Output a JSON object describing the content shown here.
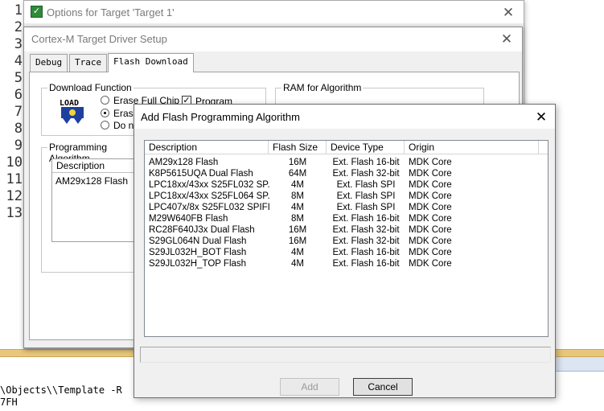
{
  "editor": {
    "line_numbers": [
      "1",
      "2",
      "3",
      "4",
      "5",
      "6",
      "7",
      "8",
      "9",
      "10",
      "11",
      "12",
      "13"
    ],
    "output_lines": [
      "\\Objects\\\\Template -R",
      "7FH"
    ]
  },
  "options_window": {
    "title": "Options for Target 'Target 1'",
    "icon": "keil-project-icon"
  },
  "cortex_window": {
    "title": "Cortex-M Target Driver Setup",
    "tabs": [
      {
        "label": "Debug"
      },
      {
        "label": "Trace"
      },
      {
        "label": "Flash Download"
      }
    ],
    "download_function": {
      "label": "Download Function",
      "load_icon_text": "LOAD",
      "erase_full_chip": "Erase Full Chip",
      "erase_sectors": "Erase",
      "do_not_erase": "Do n",
      "selected_erase": "erase_sectors",
      "program": "Program",
      "program_checked": true
    },
    "ram_for_algorithm": {
      "label": "RAM for Algorithm"
    },
    "programming_algorithm": {
      "label": "Programming Algorithm",
      "header_description": "Description",
      "items": [
        "AM29x128 Flash"
      ]
    }
  },
  "add_dialog": {
    "title": "Add Flash Programming Algorithm",
    "columns": [
      "Description",
      "Flash Size",
      "Device Type",
      "Origin"
    ],
    "rows": [
      [
        "AM29x128 Flash",
        "16M",
        "Ext. Flash 16-bit",
        "MDK Core"
      ],
      [
        "K8P5615UQA Dual Flash",
        "64M",
        "Ext. Flash 32-bit",
        "MDK Core"
      ],
      [
        "LPC18xx/43xx S25FL032 SP...",
        "4M",
        "Ext. Flash SPI",
        "MDK Core"
      ],
      [
        "LPC18xx/43xx S25FL064 SP...",
        "8M",
        "Ext. Flash SPI",
        "MDK Core"
      ],
      [
        "LPC407x/8x S25FL032 SPIFI",
        "4M",
        "Ext. Flash SPI",
        "MDK Core"
      ],
      [
        "M29W640FB Flash",
        "8M",
        "Ext. Flash 16-bit",
        "MDK Core"
      ],
      [
        "RC28F640J3x Dual Flash",
        "16M",
        "Ext. Flash 32-bit",
        "MDK Core"
      ],
      [
        "S29GL064N Dual Flash",
        "16M",
        "Ext. Flash 32-bit",
        "MDK Core"
      ],
      [
        "S29JL032H_BOT Flash",
        "4M",
        "Ext. Flash 16-bit",
        "MDK Core"
      ],
      [
        "S29JL032H_TOP Flash",
        "4M",
        "Ext. Flash 16-bit",
        "MDK Core"
      ]
    ],
    "status_text": "",
    "add_label": "Add",
    "cancel_label": "Cancel"
  },
  "colors": {
    "splitter": "#e8c77a",
    "window_bg": "#f0f0f0",
    "keil_icon": "#2f8a3a"
  }
}
